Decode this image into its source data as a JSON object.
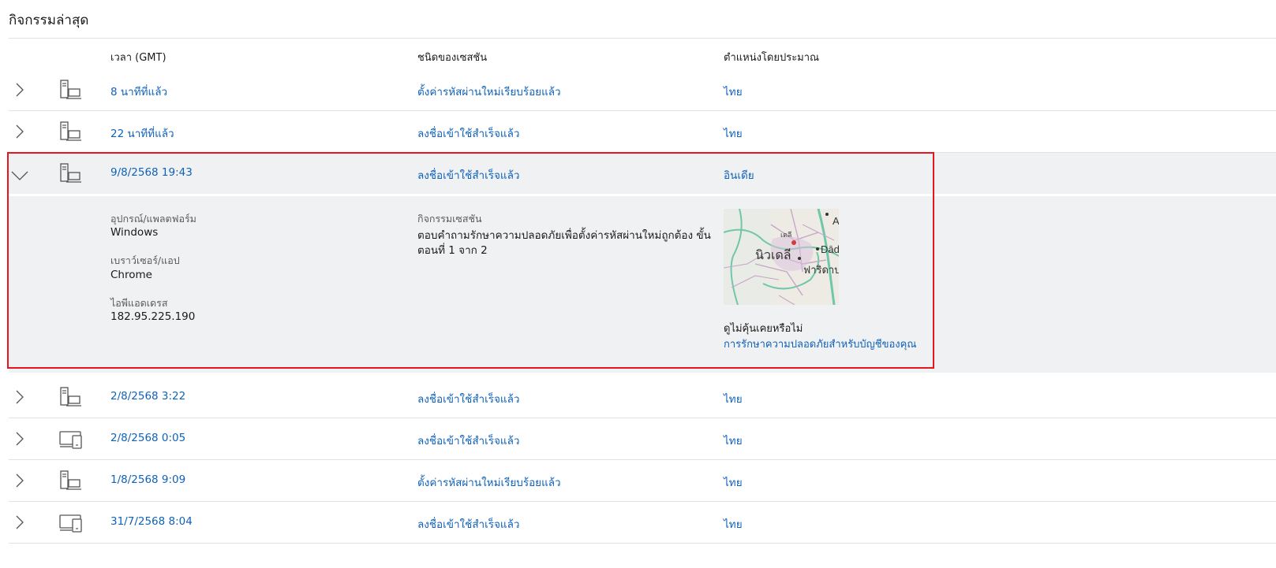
{
  "page": {
    "title": "กิจกรรมล่าสุด"
  },
  "columns": {
    "time": "เวลา (GMT)",
    "session_type": "ชนิดของเซสชัน",
    "location": "ตำแหน่งโดยประมาณ"
  },
  "rows": [
    {
      "time": "8 นาทีที่แล้ว",
      "session": "ตั้งค่ารหัสผ่านใหม่เรียบร้อยแล้ว",
      "location": "ไทย",
      "device_icon": "desktop-computer-icon"
    },
    {
      "time": "22 นาทีที่แล้ว",
      "session": "ลงชื่อเข้าใช้สำเร็จแล้ว",
      "location": "ไทย",
      "device_icon": "desktop-computer-icon"
    },
    {
      "time": "9/8/2568 19:43",
      "session": "ลงชื่อเข้าใช้สำเร็จแล้ว",
      "location": "อินเดีย",
      "device_icon": "desktop-computer-icon"
    },
    {
      "time": "2/8/2568 3:22",
      "session": "ลงชื่อเข้าใช้สำเร็จแล้ว",
      "location": "ไทย",
      "device_icon": "desktop-computer-icon"
    },
    {
      "time": "2/8/2568 0:05",
      "session": "ลงชื่อเข้าใช้สำเร็จแล้ว",
      "location": "ไทย",
      "device_icon": "laptop-tablet-icon"
    },
    {
      "time": "1/8/2568 9:09",
      "session": "ตั้งค่ารหัสผ่านใหม่เรียบร้อยแล้ว",
      "location": "ไทย",
      "device_icon": "desktop-computer-icon"
    },
    {
      "time": "31/7/2568 8:04",
      "session": "ลงชื่อเข้าใช้สำเร็จแล้ว",
      "location": "ไทย",
      "device_icon": "laptop-tablet-icon"
    }
  ],
  "details": {
    "device_label": "อุปกรณ์/แพลตฟอร์ม",
    "device_value": "Windows",
    "browser_label": "เบราว์เซอร์/แอป",
    "browser_value": "Chrome",
    "ip_label": "ไอพีแอดเดรส",
    "ip_value": "182.95.225.190",
    "activity_label": "กิจกรรมเซสชัน",
    "activity_value_line1": "ตอบคำถามรักษาความปลอดภัยเพื่อตั้งค่ารหัสผ่านใหม่ถูกต้อง ขั้น",
    "activity_value_line2": "ตอนที่ 1 จาก 2",
    "map": {
      "city_label": "นิวเดลี",
      "city_small": "เดลี",
      "place_right": "Dād",
      "place_bottom": "ฟาริดาบ",
      "place_top": "A"
    },
    "unfamiliar_heading": "ดูไม่คุ้นเคยหรือไม่",
    "security_link": "การรักษาความปลอดภัยสำหรับบัญชีของคุณ"
  },
  "colors": {
    "link": "#0f62b8",
    "highlight_border": "#e8141e",
    "expanded_bg": "#f0f1f2"
  }
}
